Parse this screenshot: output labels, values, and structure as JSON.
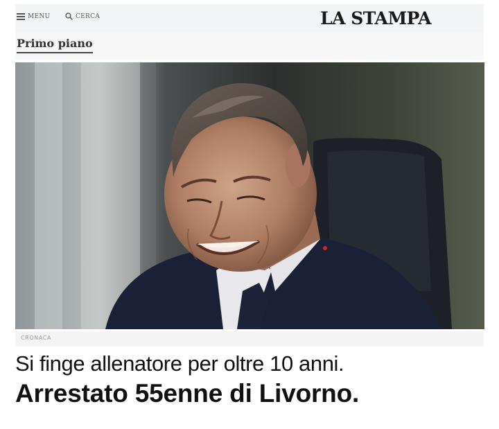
{
  "header": {
    "menu_label": "MENU",
    "search_label": "CERCA",
    "logo": "LA STAMPA"
  },
  "section": {
    "label": "Primo piano"
  },
  "article": {
    "kicker": "CRONACA",
    "headline_line1": "Si finge allenatore per oltre 10 anni.",
    "headline_line2": "Arrestato 55enne di Livorno."
  },
  "icons": {
    "menu": "hamburger-icon",
    "search": "search-icon"
  },
  "colors": {
    "accent_text": "#111111",
    "topbar_bg": "#f3f4f6",
    "kicker_text": "#999999"
  }
}
